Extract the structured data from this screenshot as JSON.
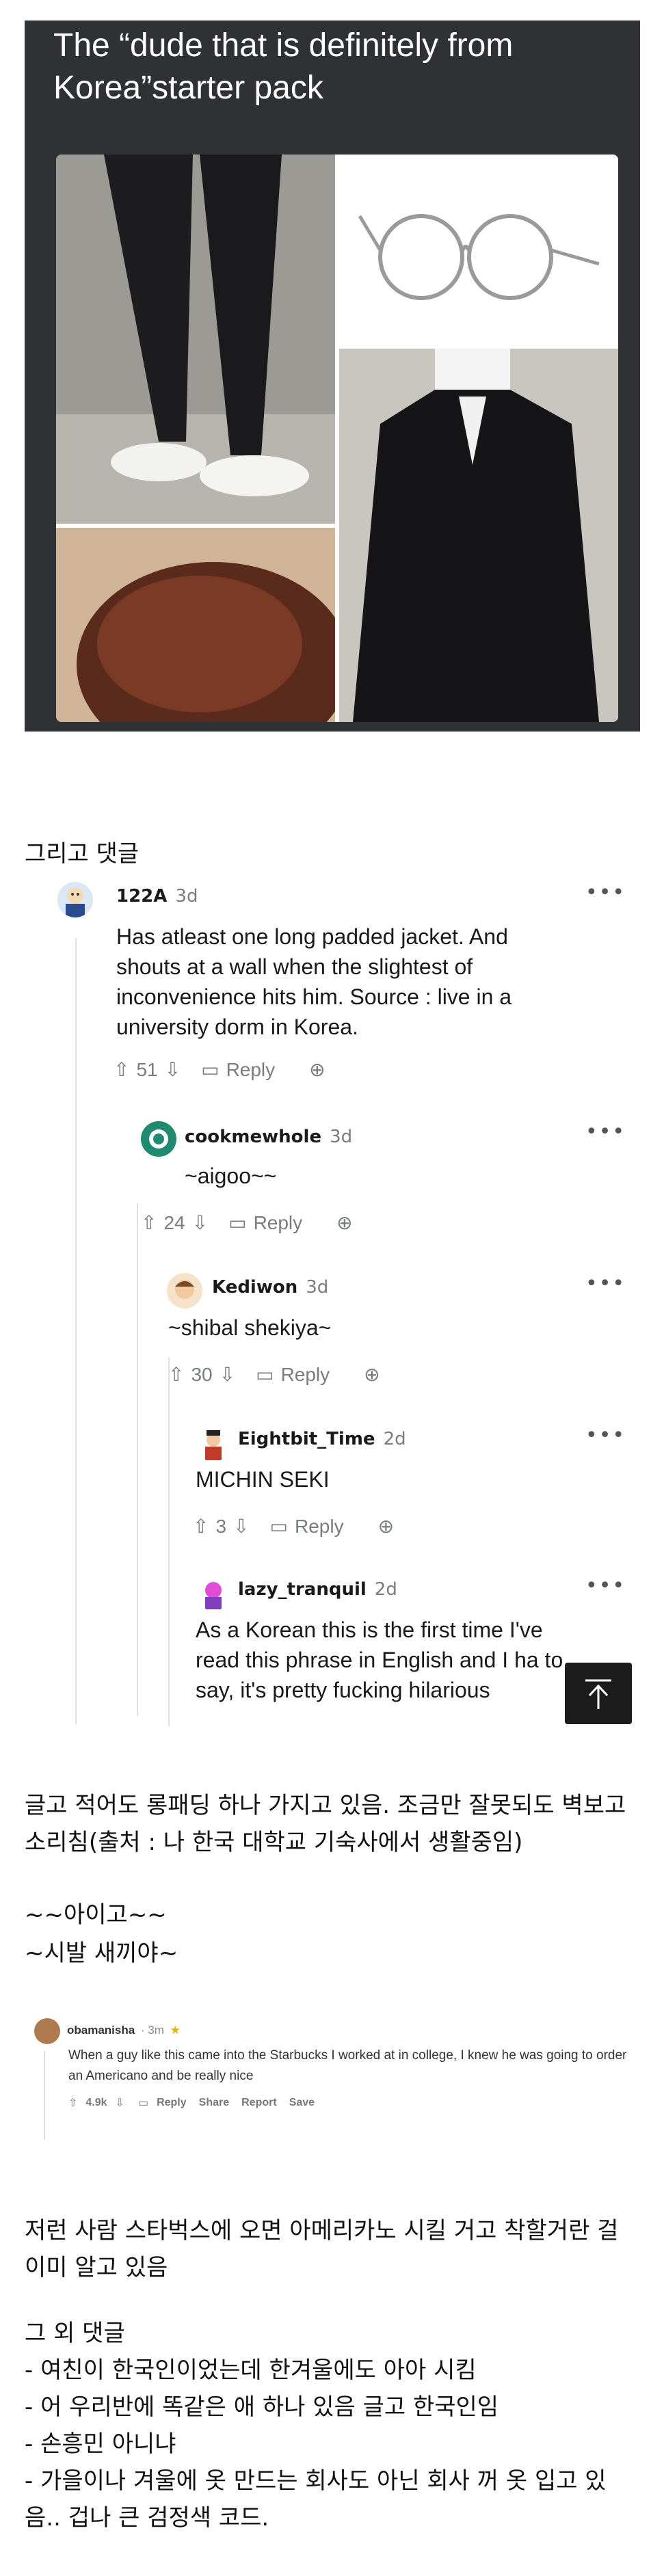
{
  "meme": {
    "title": "The “dude that is definitely from Korea”starter pack"
  },
  "section1": {
    "heading": "그리고 댓글"
  },
  "thread": [
    {
      "user": "122A",
      "age": "3d",
      "text": "Has atleast one long padded jacket. And shouts at a wall when the slightest of inconvenience hits him. Source : live in a university dorm in Korea.",
      "votes": "51",
      "reply": "Reply"
    },
    {
      "user": "cookmewhole",
      "age": "3d",
      "text": "~aigoo~~",
      "votes": "24",
      "reply": "Reply"
    },
    {
      "user": "Kediwon",
      "age": "3d",
      "text": "~shibal shekiya~",
      "votes": "30",
      "reply": "Reply"
    },
    {
      "user": "Eightbit_Time",
      "age": "2d",
      "text": "MICHIN SEKI",
      "votes": "3",
      "reply": "Reply"
    },
    {
      "user": "lazy_tranquil",
      "age": "2d",
      "text": "As a Korean this is the first time I've read this phrase in English and I ha to say, it's pretty fucking hilarious"
    }
  ],
  "translation1": {
    "para": "글고 적어도 롱패딩 하나 가지고 있음. 조금만 잘못되도 벽보고 소리침(출처 : 나 한국 대학교 기숙사에서 생활중임)",
    "line1": "~~아이고~~",
    "line2": "~시발 새끼야~"
  },
  "small_comment": {
    "user": "obamanisha",
    "age": "· 3m",
    "text": "When a guy like this came into the Starbucks I worked at in college, I knew he was going to order an Americano and be really nice",
    "votes": "4.9k",
    "reply": "Reply",
    "share": "Share",
    "report": "Report",
    "save": "Save"
  },
  "translation2": {
    "para": "저런 사람 스타벅스에 오면 아메리카노 시킬 거고 착할거란 걸 이미 알고 있음"
  },
  "others": {
    "heading": "그 외 댓글",
    "items": [
      "- 여친이 한국인이었는데 한겨울에도 아아 시킴",
      "- 어 우리반에 똑같은 애 하나 있음 글고 한국인임",
      "- 손흥민 아니냐",
      "- 가을이나 겨울에 옷 만드는 회사도 아닌 회사 꺼 옷 입고 있음.. 겁나 큰 검정색 코드."
    ]
  },
  "colors": {
    "accent_dark": "#2f3135",
    "meta": "#787c7e",
    "rail": "#e0e0e0"
  }
}
